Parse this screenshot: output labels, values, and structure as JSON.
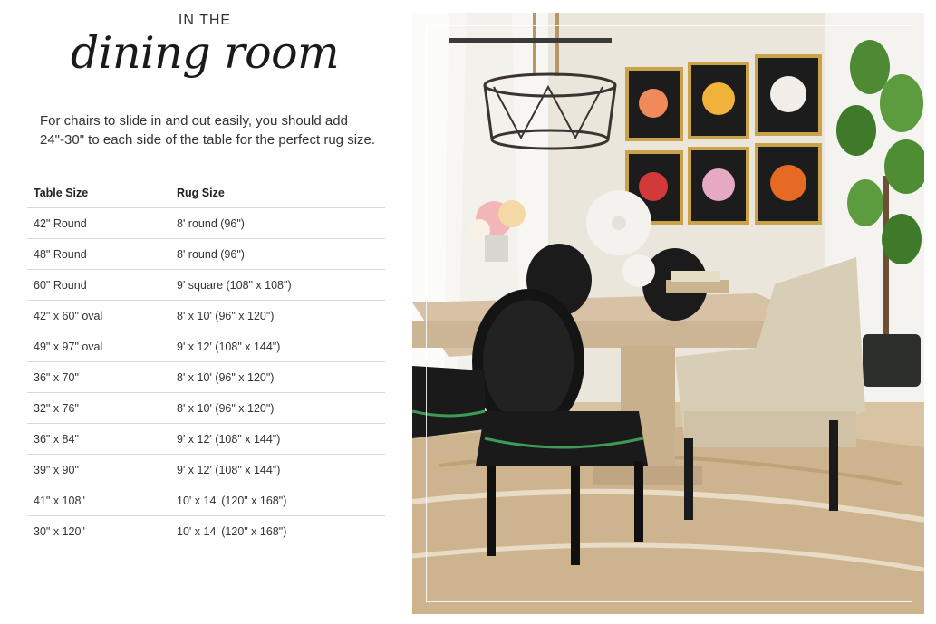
{
  "header": {
    "eyebrow": "IN THE",
    "title": "dining room"
  },
  "intro": "For chairs to slide in and out easily, you should add 24\"-30\" to each side of the table for the perfect rug size.",
  "table": {
    "headers": [
      "Table Size",
      "Rug Size"
    ],
    "rows": [
      [
        "42\" Round",
        "8' round (96\")"
      ],
      [
        "48\" Round",
        "8' round (96\")"
      ],
      [
        "60\" Round",
        "9' square (108\" x 108\")"
      ],
      [
        "42\" x 60\" oval",
        "8' x 10' (96\" x 120\")"
      ],
      [
        "49\" x 97\" oval",
        "9' x 12' (108\" x 144\")"
      ],
      [
        "36\" x 70\"",
        "8' x 10' (96\" x 120\")"
      ],
      [
        "32\" x 76\"",
        "8' x 10' (96\" x 120\")"
      ],
      [
        "36\" x 84\"",
        "9' x 12' (108\" x 144\")"
      ],
      [
        "39\" x 90\"",
        "9' x 12' (108\" x 144\")"
      ],
      [
        "41\" x 108\"",
        "10' x 14' (120\" x 168\")"
      ],
      [
        "30\" x 120\"",
        "10' x 14' (120\" x 168\")"
      ]
    ]
  }
}
